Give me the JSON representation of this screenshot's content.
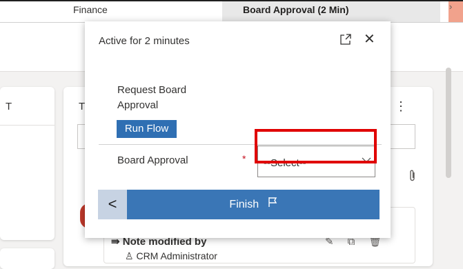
{
  "stages": {
    "previous": "Finance",
    "active": "Board Approval  (2 Min)"
  },
  "background": {
    "left_card_initial": "T",
    "right_card_initial": "T",
    "note_title": "Note modified by",
    "note_author": "CRM Administrator"
  },
  "dialog": {
    "status": "Active for 2 minutes",
    "step_label": "Request Board Approval",
    "run_button": "Run Flow",
    "field_label": "Board Approval",
    "required_marker": "*",
    "select_value": "--Select--",
    "back_label": "<",
    "finish_label": "Finish"
  },
  "icons": [
    "expand-icon",
    "close-icon",
    "flag-icon",
    "chevron-down-icon",
    "attach-icon",
    "more-icon",
    "pen-icon",
    "copy-icon",
    "delete-icon",
    "user-icon",
    "note-icon"
  ],
  "colors": {
    "primary": "#3a76b6",
    "run_button": "#2f6fb3",
    "highlight": "#e00000",
    "required": "#c50f1f"
  }
}
